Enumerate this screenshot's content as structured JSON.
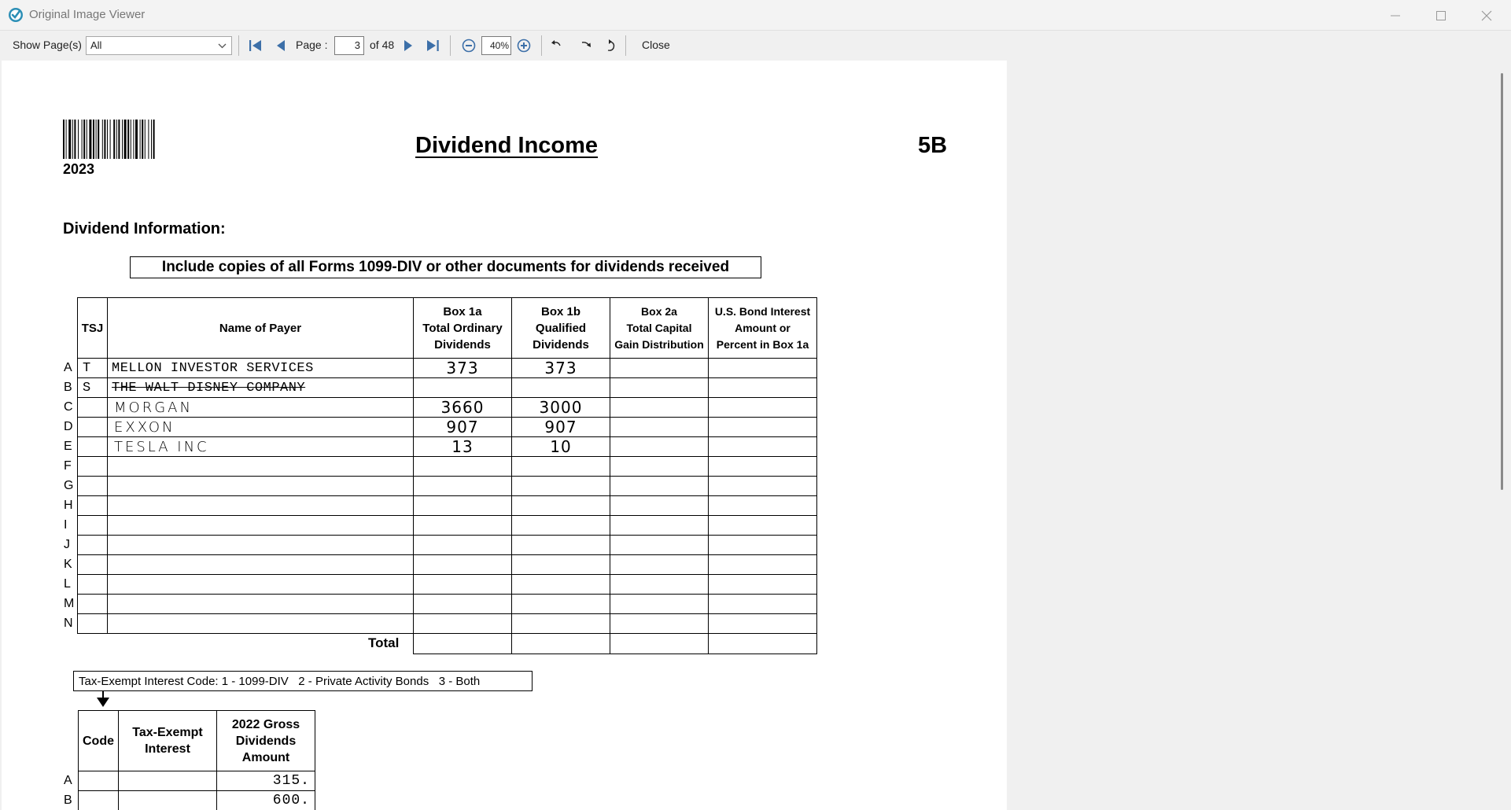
{
  "window": {
    "title": "Original Image Viewer"
  },
  "toolbar": {
    "show_pages_label": "Show Page(s)",
    "show_pages_value": "All",
    "page_label": "Page :",
    "page_value": "3",
    "page_of": "of 48",
    "zoom_value": "40%",
    "close_label": "Close",
    "icons": [
      "first-page-icon",
      "previous-page-icon",
      "next-page-icon",
      "last-page-icon",
      "zoom-out-icon",
      "zoom-in-icon",
      "rotate-left-icon",
      "rotate-right-icon",
      "rotate-clockwise-icon"
    ]
  },
  "document": {
    "year": "2023",
    "title": "Dividend Income",
    "form_code": "5B",
    "section_heading": "Dividend Information:",
    "instruction": "Include copies of all Forms 1099-DIV or other documents for dividends received",
    "columns": {
      "tsj": "TSJ",
      "payer": "Name of Payer",
      "box1a": [
        "Box 1a",
        "Total Ordinary",
        "Dividends"
      ],
      "box1b": [
        "Box 1b",
        "Qualified",
        "Dividends"
      ],
      "box2a": [
        "Box 2a",
        "Total Capital",
        "Gain Distribution"
      ],
      "usbond": [
        "U.S. Bond Interest",
        "Amount or",
        "Percent in Box 1a"
      ]
    },
    "rows": [
      {
        "label": "A",
        "tsj": "T",
        "payer": "MELLON INVESTOR SERVICES",
        "box1a": "373",
        "box1b": "373",
        "style": "typed"
      },
      {
        "label": "B",
        "tsj": "S",
        "payer": "THE WALT DISNEY COMPANY",
        "box1a": "",
        "box1b": "",
        "style": "typed-struck"
      },
      {
        "label": "C",
        "tsj": "",
        "payer": "MORGAN",
        "box1a": "3660",
        "box1b": "3000",
        "style": "hand"
      },
      {
        "label": "D",
        "tsj": "",
        "payer": "EXXON",
        "box1a": "907",
        "box1b": "907",
        "style": "hand"
      },
      {
        "label": "E",
        "tsj": "",
        "payer": "TESLA INC",
        "box1a": "13",
        "box1b": "10",
        "style": "hand"
      },
      {
        "label": "F",
        "tsj": "",
        "payer": "",
        "box1a": "",
        "box1b": "",
        "style": "typed"
      },
      {
        "label": "G",
        "tsj": "",
        "payer": "",
        "box1a": "",
        "box1b": "",
        "style": "typed"
      },
      {
        "label": "H",
        "tsj": "",
        "payer": "",
        "box1a": "",
        "box1b": "",
        "style": "typed"
      },
      {
        "label": "I",
        "tsj": "",
        "payer": "",
        "box1a": "",
        "box1b": "",
        "style": "typed"
      },
      {
        "label": "J",
        "tsj": "",
        "payer": "",
        "box1a": "",
        "box1b": "",
        "style": "typed"
      },
      {
        "label": "K",
        "tsj": "",
        "payer": "",
        "box1a": "",
        "box1b": "",
        "style": "typed"
      },
      {
        "label": "L",
        "tsj": "",
        "payer": "",
        "box1a": "",
        "box1b": "",
        "style": "typed"
      },
      {
        "label": "M",
        "tsj": "",
        "payer": "",
        "box1a": "",
        "box1b": "",
        "style": "typed"
      },
      {
        "label": "N",
        "tsj": "",
        "payer": "",
        "box1a": "",
        "box1b": "",
        "style": "typed"
      }
    ],
    "total_label": "Total",
    "tax_exempt_legend": "Tax-Exempt Interest Code: 1 - 1099-DIV   2 - Private Activity Bonds   3 - Both",
    "tax_exempt_columns": {
      "code": "Code",
      "interest": [
        "Tax-Exempt",
        "Interest"
      ],
      "gross": [
        "2022 Gross",
        "Dividends",
        "Amount"
      ]
    },
    "tax_exempt_rows": [
      {
        "label": "A",
        "code": "",
        "interest": "",
        "gross": "315."
      },
      {
        "label": "B",
        "code": "",
        "interest": "",
        "gross": "600."
      }
    ]
  }
}
